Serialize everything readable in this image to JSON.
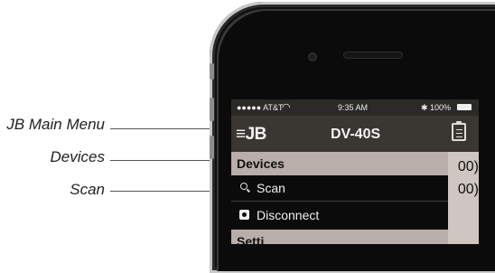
{
  "callouts": {
    "main_menu": "JB Main Menu",
    "devices": "Devices",
    "scan": "Scan"
  },
  "status_bar": {
    "carrier": "●●●●● AT&T",
    "wifi_icon": "wifi-icon",
    "time": "9:35 AM",
    "battery": "✱ 100%"
  },
  "nav": {
    "menu_label": "≡JB",
    "title": "DV-40S",
    "right_icon": "clipboard-icon"
  },
  "menu": {
    "section_devices": "Devices",
    "scan_label": "Scan",
    "disconnect_label": "Disconnect",
    "section_settings_partial": "Setti"
  },
  "background": {
    "value_1": "00)",
    "value_2": "00)"
  }
}
